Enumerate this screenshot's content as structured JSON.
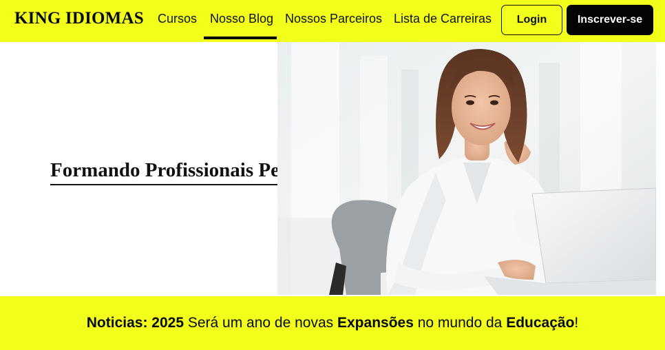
{
  "navbar": {
    "brand": "KING IDIOMAS",
    "links": [
      {
        "label": "Cursos",
        "active": false
      },
      {
        "label": "Nosso Blog",
        "active": true
      },
      {
        "label": "Nossos Parceiros",
        "active": false
      },
      {
        "label": "Lista de Carreiras",
        "active": false
      }
    ],
    "login_label": "Login",
    "signup_label": "Inscrever-se"
  },
  "hero": {
    "title": "Formando Profissionais Pelo Mundo",
    "photo_icon": "woman-with-laptop-photo"
  },
  "news": {
    "label": "Noticias:",
    "year": "2025",
    "text1": "Será um ano de novas",
    "highlight1": "Expansões",
    "text2": "no mundo da",
    "highlight2": "Educação",
    "end": "!"
  },
  "colors": {
    "accent": "#f2ff1b",
    "dark": "#050505",
    "text": "#111111"
  }
}
